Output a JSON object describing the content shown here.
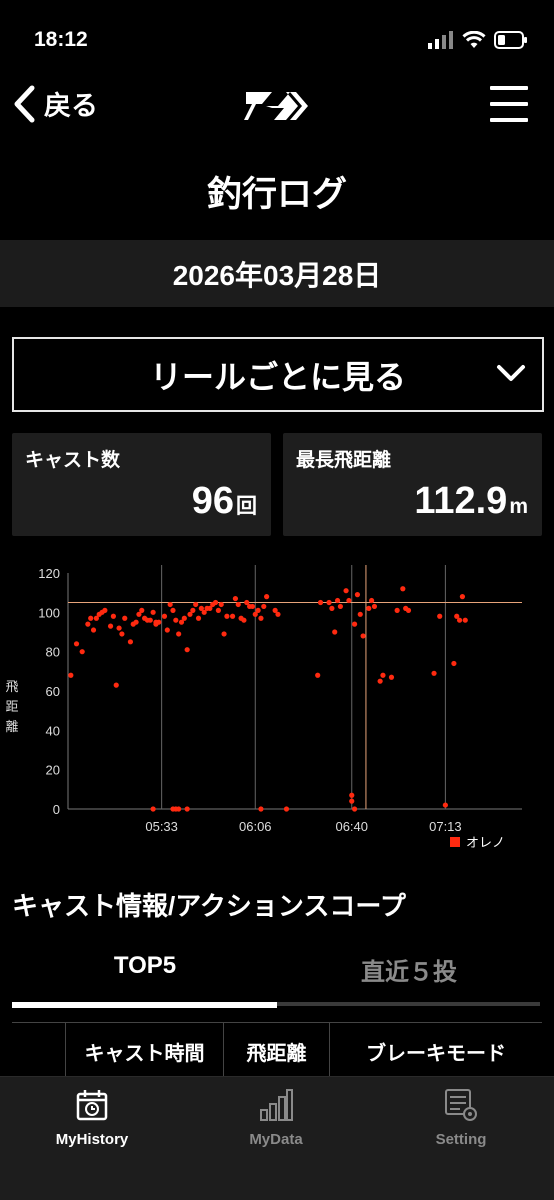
{
  "status": {
    "time": "18:12"
  },
  "nav": {
    "back_label": "戻る"
  },
  "page": {
    "title": "釣行ログ",
    "date": "2026年03月28日"
  },
  "selector": {
    "label": "リールごとに見る"
  },
  "stats": {
    "cast_count": {
      "label": "キャスト数",
      "value": "96",
      "unit": "回"
    },
    "max_distance": {
      "label": "最長飛距離",
      "value": "112.9",
      "unit": "m"
    }
  },
  "chart_data": {
    "type": "scatter",
    "ylabel": "飛距離",
    "ylim": [
      0,
      120
    ],
    "yticks": [
      "0",
      "20",
      "40",
      "60",
      "80",
      "100",
      "120"
    ],
    "xticks": [
      "05:33",
      "06:06",
      "06:40",
      "07:13"
    ],
    "x_minutes_from_0500": [
      33,
      66,
      100,
      133
    ],
    "x_range_minutes_from_0500": [
      0,
      160
    ],
    "reference_line_y": 105,
    "reference_line_x_minutes_from_0500": [
      105
    ],
    "legend": [
      "オレノ"
    ],
    "color": "#ff2a10",
    "series": [
      {
        "name": "オレノ",
        "points": [
          [
            1,
            68
          ],
          [
            3,
            84
          ],
          [
            5,
            80
          ],
          [
            7,
            94
          ],
          [
            8,
            97
          ],
          [
            9,
            91
          ],
          [
            10,
            97
          ],
          [
            11,
            99
          ],
          [
            12,
            100
          ],
          [
            13,
            101
          ],
          [
            15,
            93
          ],
          [
            16,
            98
          ],
          [
            17,
            63
          ],
          [
            18,
            92
          ],
          [
            19,
            89
          ],
          [
            20,
            97
          ],
          [
            22,
            85
          ],
          [
            23,
            94
          ],
          [
            24,
            95
          ],
          [
            25,
            99
          ],
          [
            26,
            101
          ],
          [
            27,
            97
          ],
          [
            28,
            96
          ],
          [
            29,
            96
          ],
          [
            30,
            100
          ],
          [
            31,
            95
          ],
          [
            31,
            94
          ],
          [
            32,
            95
          ],
          [
            34,
            98
          ],
          [
            35,
            91
          ],
          [
            36,
            104
          ],
          [
            37,
            101
          ],
          [
            38,
            96
          ],
          [
            39,
            89
          ],
          [
            40,
            95
          ],
          [
            41,
            97
          ],
          [
            42,
            81
          ],
          [
            43,
            99
          ],
          [
            44,
            101
          ],
          [
            45,
            104
          ],
          [
            46,
            97
          ],
          [
            47,
            102
          ],
          [
            48,
            100
          ],
          [
            49,
            102
          ],
          [
            50,
            102
          ],
          [
            51,
            104
          ],
          [
            52,
            105
          ],
          [
            53,
            101
          ],
          [
            54,
            104
          ],
          [
            55,
            89
          ],
          [
            56,
            98
          ],
          [
            58,
            98
          ],
          [
            59,
            107
          ],
          [
            60,
            104
          ],
          [
            61,
            97
          ],
          [
            62,
            96
          ],
          [
            63,
            105
          ],
          [
            64,
            103
          ],
          [
            65,
            103
          ],
          [
            66,
            99
          ],
          [
            67,
            101
          ],
          [
            68,
            97
          ],
          [
            69,
            103
          ],
          [
            70,
            108
          ],
          [
            73,
            101
          ],
          [
            74,
            99
          ],
          [
            88,
            68
          ],
          [
            89,
            105
          ],
          [
            92,
            105
          ],
          [
            93,
            102
          ],
          [
            94,
            90
          ],
          [
            95,
            106
          ],
          [
            96,
            103
          ],
          [
            98,
            111
          ],
          [
            99,
            106
          ],
          [
            100,
            7
          ],
          [
            100,
            4
          ],
          [
            101,
            94
          ],
          [
            102,
            109
          ],
          [
            103,
            99
          ],
          [
            104,
            88
          ],
          [
            106,
            102
          ],
          [
            107,
            106
          ],
          [
            108,
            103
          ],
          [
            110,
            65
          ],
          [
            111,
            68
          ],
          [
            114,
            67
          ],
          [
            116,
            101
          ],
          [
            118,
            112
          ],
          [
            119,
            102
          ],
          [
            120,
            101
          ],
          [
            129,
            69
          ],
          [
            131,
            98
          ],
          [
            133,
            2
          ],
          [
            136,
            74
          ],
          [
            137,
            98
          ],
          [
            138,
            96
          ],
          [
            139,
            108
          ],
          [
            140,
            96
          ]
        ],
        "zero_points_minutes": [
          30,
          37,
          38,
          39,
          42,
          68,
          77,
          101
        ]
      }
    ]
  },
  "section": {
    "title": "キャスト情報/アクションスコープ"
  },
  "tabs": [
    {
      "label": "TOP5"
    },
    {
      "label": "直近５投"
    }
  ],
  "table": {
    "headers": [
      "キャスト時間",
      "飛距離",
      "ブレーキモード"
    ]
  },
  "tabbar": [
    {
      "label": "MyHistory"
    },
    {
      "label": "MyData"
    },
    {
      "label": "Setting"
    }
  ],
  "colors": {
    "accent": "#ff2a10",
    "background": "#000000",
    "card": "#1e1e1e",
    "inactive": "#8a8a8a",
    "ref_line": "#e8a47a"
  }
}
